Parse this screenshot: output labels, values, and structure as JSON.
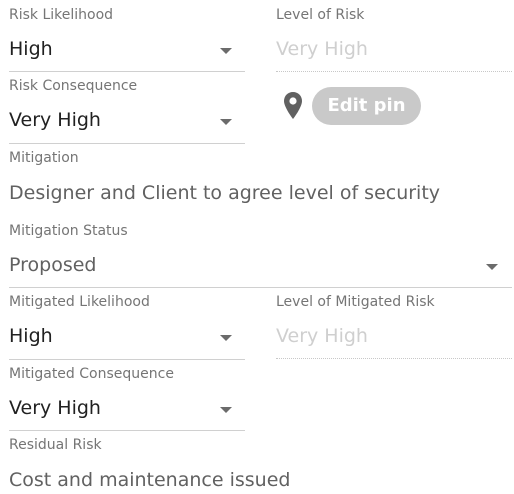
{
  "risk_likelihood": {
    "label": "Risk Likelihood",
    "value": "High"
  },
  "level_of_risk": {
    "label": "Level of Risk",
    "value": "Very High"
  },
  "risk_consequence": {
    "label": "Risk Consequence",
    "value": "Very High"
  },
  "edit_pin": {
    "label": "Edit pin",
    "icon": "map-pin-icon"
  },
  "mitigation": {
    "label": "Mitigation",
    "value": "Designer and Client to agree level of security"
  },
  "mitigation_status": {
    "label": "Mitigation Status",
    "value": "Proposed"
  },
  "mitigated_likelihood": {
    "label": "Mitigated Likelihood",
    "value": "High"
  },
  "level_of_mitigated_risk": {
    "label": "Level of Mitigated Risk",
    "value": "Very High"
  },
  "mitigated_consequence": {
    "label": "Mitigated Consequence",
    "value": "Very High"
  },
  "residual_risk": {
    "label": "Residual Risk",
    "value": "Cost and maintenance issued"
  },
  "colors": {
    "button_bg": "#c9c9c9",
    "muted_text": "#cfcfcf",
    "label_text": "#757575"
  }
}
